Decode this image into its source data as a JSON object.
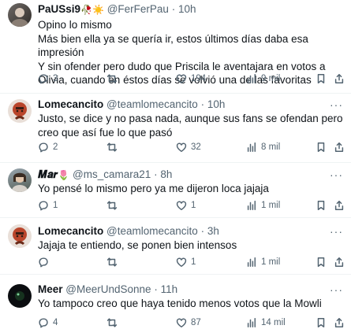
{
  "colors": {
    "text": "#0f1419",
    "muted": "#536471",
    "divider": "#eff3f4"
  },
  "tweets": [
    {
      "name": "PaUSsi9",
      "name_emoji": "🥀☀️",
      "handle": "@FerFerPau",
      "time": "10h",
      "text": "Opino lo mismo\nMás bien ella ya se quería ir, estos últimos días daba esa impresión\nY sin ofender pero dudo que Priscila le aventajara en votos a Olivia, cuando en éstos días se volvió una de las favoritas",
      "replies": "3",
      "retweets": "",
      "likes": "194",
      "views": "9 mil"
    },
    {
      "name": "Lomecancito",
      "handle": "@teamlomecancito",
      "time": "10h",
      "text": "Justo, se dice y no pasa nada, aunque sus fans se ofendan pero creo que así fue lo que pasó",
      "replies": "2",
      "retweets": "",
      "likes": "32",
      "views": "8 mil"
    },
    {
      "name": "𝑴𝒂𝒓",
      "name_emoji": "🌷",
      "handle": "@ms_camara21",
      "time": "8h",
      "text": "Yo pensé lo mismo pero ya me dijeron loca jajaja",
      "replies": "1",
      "retweets": "",
      "likes": "1",
      "views": "1 mil"
    },
    {
      "name": "Lomecancito",
      "handle": "@teamlomecancito",
      "time": "3h",
      "text": "Jajaja te entiendo, se ponen bien intensos",
      "replies": "",
      "retweets": "",
      "likes": "1",
      "views": "1 mil"
    },
    {
      "name": "Meer",
      "handle": "@MeerUndSonne",
      "time": "11h",
      "text": "Yo tampoco creo que haya tenido menos votos que la Mowli",
      "replies": "4",
      "retweets": "",
      "likes": "87",
      "views": "14 mil"
    }
  ],
  "ui": {
    "separator": "·",
    "more": "···"
  },
  "icons": {
    "reply": "reply-icon",
    "retweet": "retweet-icon",
    "like": "heart-icon",
    "views": "views-icon",
    "bookmark": "bookmark-icon",
    "share": "share-icon"
  }
}
